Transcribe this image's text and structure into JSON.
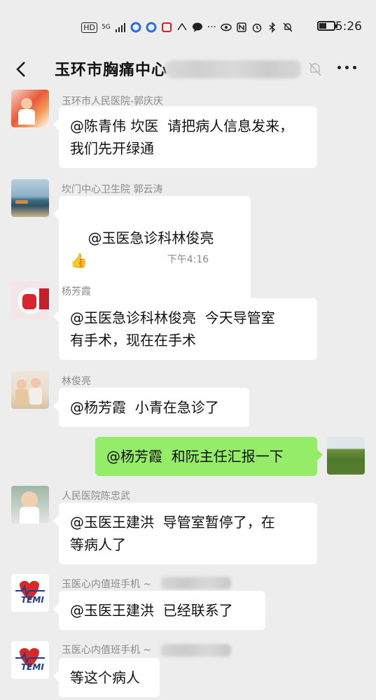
{
  "status_bar": {
    "network_label": "HD",
    "signal_label": "5G",
    "time": "5:26"
  },
  "header": {
    "title": "玉环市胸痛中心"
  },
  "messages": [
    {
      "sender": "玉环市人民医院-郭庆庆",
      "text": "@陈青伟 坎医  请把病人信息发来，\n我们先开绿通"
    },
    {
      "sender": "坎门中心卫生院 郭云涛",
      "text": "@玉医急诊科林俊亮  👍"
    },
    {
      "sender": "杨芳霞",
      "text": "@玉医急诊科林俊亮  今天导管室\n有手术，现在在手术"
    },
    {
      "sender": "林俊亮",
      "text": "@杨芳霞  小青在急诊了"
    },
    {
      "sender": "",
      "text": "@杨芳霞  和阮主任汇报一下"
    },
    {
      "sender": "人民医院陈忠武",
      "text": "@玉医王建洪  导管室暂停了，在\n等病人了"
    },
    {
      "sender": "玉医心内值班手机 ~",
      "text": "@玉医王建洪  已经联系了"
    },
    {
      "sender": "玉医心内值班手机 ~",
      "text": "等这个病人"
    }
  ],
  "timestamp": "下午4:16",
  "avatar_logo_text": "TEMI",
  "colors": {
    "background": "#ededed",
    "self_bubble": "#95ec69",
    "other_bubble": "#ffffff",
    "sender_text": "#8a8a8a"
  }
}
